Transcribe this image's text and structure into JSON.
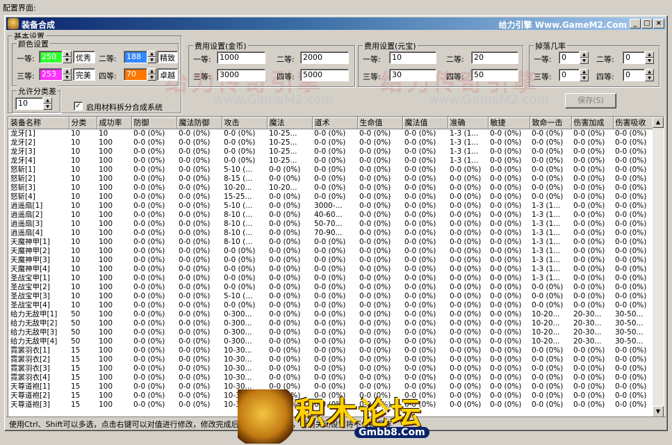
{
  "caption": "配置界面:",
  "window": {
    "title": "装备合成",
    "brand": "给力引擎 Www.GameM2.Com",
    "min_glyph": "_",
    "max_glyph": "□",
    "close_glyph": "×"
  },
  "basic": {
    "group_title": "基本设置",
    "color_group_title": "颜色设置",
    "grades": [
      {
        "label": "一等:",
        "value": "250",
        "color": "#33ff33",
        "name": "优秀"
      },
      {
        "label": "二等:",
        "value": "188",
        "color": "#3388ff",
        "name": "精致"
      },
      {
        "label": "三等:",
        "value": "253",
        "color": "#ff33ff",
        "name": "完美"
      },
      {
        "label": "四等:",
        "value": "70",
        "color": "#ff7700",
        "name": "卓越"
      }
    ],
    "diff_title": "允许分类差",
    "diff_value": "10",
    "checkbox_label": "启用材料拆分合成系统",
    "checkbox_checked": "✓"
  },
  "gold": {
    "title": "费用设置(金币)",
    "items": [
      {
        "label": "一等:",
        "value": "1000"
      },
      {
        "label": "二等:",
        "value": "2000"
      },
      {
        "label": "三等:",
        "value": "3000"
      },
      {
        "label": "四等:",
        "value": "5000"
      }
    ]
  },
  "ingot": {
    "title": "费用设置(元宝)",
    "items": [
      {
        "label": "一等:",
        "value": "10"
      },
      {
        "label": "二等:",
        "value": "20"
      },
      {
        "label": "三等:",
        "value": "30"
      },
      {
        "label": "四等:",
        "value": "50"
      }
    ]
  },
  "drop": {
    "title": "掉落几率",
    "items": [
      {
        "label": "一等:",
        "value": "0"
      },
      {
        "label": "二等:",
        "value": "0"
      },
      {
        "label": "三等:",
        "value": "0"
      },
      {
        "label": "四等:",
        "value": "0"
      }
    ]
  },
  "save_label": "保存(S)",
  "table": {
    "columns": [
      "装备名称",
      "分类",
      "成功率",
      "防御",
      "魔法防御",
      "攻击",
      "魔法",
      "道术",
      "生命值",
      "魔法值",
      "准确",
      "敏捷",
      "致命一击",
      "伤害加成",
      "伤害吸收"
    ],
    "rows": [
      [
        "龙牙[1]",
        "10",
        "10",
        "0-0 (0%)",
        "0-0 (0%)",
        "0-0 (0%)",
        "10-25...",
        "0-0 (0%)",
        "0-0 (0%)",
        "0-0 (0%)",
        "1-3 (1...",
        "0-0 (0%)",
        "0-0 (0%)",
        "0-0 (0%)",
        "0-0 (0%)"
      ],
      [
        "龙牙[2]",
        "10",
        "100",
        "0-0 (0%)",
        "0-0 (0%)",
        "0-0 (0%)",
        "10-25...",
        "0-0 (0%)",
        "0-0 (0%)",
        "0-0 (0%)",
        "1-3 (1...",
        "0-0 (0%)",
        "0-0 (0%)",
        "0-0 (0%)",
        "0-0 (0%)"
      ],
      [
        "龙牙[3]",
        "10",
        "100",
        "0-0 (0%)",
        "0-0 (0%)",
        "0-0 (0%)",
        "10-25...",
        "0-0 (0%)",
        "0-0 (0%)",
        "0-0 (0%)",
        "1-3 (1...",
        "0-0 (0%)",
        "0-0 (0%)",
        "0-0 (0%)",
        "0-0 (0%)"
      ],
      [
        "龙牙[4]",
        "10",
        "100",
        "0-0 (0%)",
        "0-0 (0%)",
        "0-0 (0%)",
        "10-25...",
        "0-0 (0%)",
        "0-0 (0%)",
        "0-0 (0%)",
        "1-3 (1...",
        "0-0 (0%)",
        "0-0 (0%)",
        "0-0 (0%)",
        "0-0 (0%)"
      ],
      [
        "怒斩[1]",
        "10",
        "100",
        "0-0 (0%)",
        "0-0 (0%)",
        "5-10 (...",
        "0-0 (0%)",
        "0-0 (0%)",
        "0-0 (0%)",
        "0-0 (0%)",
        "0-0 (0%)",
        "0-0 (0%)",
        "0-0 (0%)",
        "0-0 (0%)",
        "0-0 (0%)"
      ],
      [
        "怒斩[2]",
        "10",
        "100",
        "0-0 (0%)",
        "0-0 (0%)",
        "8-15 (...",
        "0-0 (0%)",
        "0-0 (0%)",
        "0-0 (0%)",
        "0-0 (0%)",
        "0-0 (0%)",
        "0-0 (0%)",
        "0-0 (0%)",
        "0-0 (0%)",
        "0-0 (0%)"
      ],
      [
        "怒斩[3]",
        "10",
        "100",
        "0-0 (0%)",
        "0-0 (0%)",
        "10-20...",
        "10-20...",
        "0-0 (0%)",
        "0-0 (0%)",
        "0-0 (0%)",
        "0-0 (0%)",
        "0-0 (0%)",
        "0-0 (0%)",
        "0-0 (0%)",
        "0-0 (0%)"
      ],
      [
        "怒斩[4]",
        "10",
        "100",
        "0-0 (0%)",
        "0-0 (0%)",
        "15-25...",
        "0-0 (0%)",
        "0-0 (0%)",
        "0-0 (0%)",
        "0-0 (0%)",
        "0-0 (0%)",
        "0-0 (0%)",
        "0-0 (0%)",
        "0-0 (0%)",
        "0-0 (0%)"
      ],
      [
        "逍遥扇[1]",
        "10",
        "100",
        "0-0 (0%)",
        "0-0 (0%)",
        "5-10 (...",
        "0-0 (0%)",
        "3000-...",
        "0-0 (0%)",
        "0-0 (0%)",
        "0-0 (0%)",
        "0-0 (0%)",
        "1-3 (1...",
        "0-0 (0%)",
        "0-0 (0%)"
      ],
      [
        "逍遥扇[2]",
        "10",
        "100",
        "0-0 (0%)",
        "0-0 (0%)",
        "8-10 (...",
        "0-0 (0%)",
        "40-60...",
        "0-0 (0%)",
        "0-0 (0%)",
        "0-0 (0%)",
        "0-0 (0%)",
        "1-3 (1...",
        "0-0 (0%)",
        "0-0 (0%)"
      ],
      [
        "逍遥扇[3]",
        "10",
        "100",
        "0-0 (0%)",
        "0-0 (0%)",
        "8-10 (...",
        "0-0 (0%)",
        "50-70...",
        "0-0 (0%)",
        "0-0 (0%)",
        "0-0 (0%)",
        "0-0 (0%)",
        "1-3 (1...",
        "0-0 (0%)",
        "0-0 (0%)"
      ],
      [
        "逍遥扇[4]",
        "10",
        "100",
        "0-0 (0%)",
        "0-0 (0%)",
        "8-10 (...",
        "0-0 (0%)",
        "70-90...",
        "0-0 (0%)",
        "0-0 (0%)",
        "0-0 (0%)",
        "0-0 (0%)",
        "1-3 (1...",
        "0-0 (0%)",
        "0-0 (0%)"
      ],
      [
        "天魔神甲[1]",
        "10",
        "100",
        "0-0 (0%)",
        "0-0 (0%)",
        "8-10 (...",
        "0-0 (0%)",
        "0-0 (0%)",
        "0-0 (0%)",
        "0-0 (0%)",
        "0-0 (0%)",
        "0-0 (0%)",
        "1-3 (1...",
        "0-0 (0%)",
        "0-0 (0%)"
      ],
      [
        "天魔神甲[2]",
        "10",
        "100",
        "0-0 (0%)",
        "0-0 (0%)",
        "0-0 (0%)",
        "0-0 (0%)",
        "0-0 (0%)",
        "0-0 (0%)",
        "0-0 (0%)",
        "0-0 (0%)",
        "0-0 (0%)",
        "1-3 (1...",
        "0-0 (0%)",
        "0-0 (0%)"
      ],
      [
        "天魔神甲[3]",
        "10",
        "100",
        "0-0 (0%)",
        "0-0 (0%)",
        "0-0 (0%)",
        "0-0 (0%)",
        "0-0 (0%)",
        "0-0 (0%)",
        "0-0 (0%)",
        "0-0 (0%)",
        "0-0 (0%)",
        "1-3 (1...",
        "0-0 (0%)",
        "0-0 (0%)"
      ],
      [
        "天魔神甲[4]",
        "10",
        "100",
        "0-0 (0%)",
        "0-0 (0%)",
        "0-0 (0%)",
        "0-0 (0%)",
        "0-0 (0%)",
        "0-0 (0%)",
        "0-0 (0%)",
        "0-0 (0%)",
        "0-0 (0%)",
        "1-3 (1...",
        "0-0 (0%)",
        "0-0 (0%)"
      ],
      [
        "圣战宝甲[1]",
        "10",
        "100",
        "0-0 (0%)",
        "0-0 (0%)",
        "0-0 (0%)",
        "0-0 (0%)",
        "0-0 (0%)",
        "0-0 (0%)",
        "0-0 (0%)",
        "0-0 (0%)",
        "0-0 (0%)",
        "1-3 (1...",
        "0-0 (0%)",
        "0-0 (0%)"
      ],
      [
        "圣战宝甲[2]",
        "10",
        "100",
        "0-0 (0%)",
        "0-0 (0%)",
        "0-0 (0%)",
        "0-0 (0%)",
        "0-0 (0%)",
        "0-0 (0%)",
        "0-0 (0%)",
        "0-0 (0%)",
        "0-0 (0%)",
        "0-0 (0%)",
        "0-0 (0%)",
        "0-0 (0%)"
      ],
      [
        "圣战宝甲[3]",
        "10",
        "100",
        "0-0 (0%)",
        "0-0 (0%)",
        "5-10 (...",
        "0-0 (0%)",
        "0-0 (0%)",
        "0-0 (0%)",
        "0-0 (0%)",
        "0-0 (0%)",
        "0-0 (0%)",
        "0-0 (0%)",
        "0-0 (0%)",
        "0-0 (0%)"
      ],
      [
        "圣战宝甲[4]",
        "10",
        "100",
        "0-0 (0%)",
        "0-0 (0%)",
        "0-0 (0%)",
        "0-0 (0%)",
        "0-0 (0%)",
        "0-0 (0%)",
        "0-0 (0%)",
        "0-0 (0%)",
        "0-0 (0%)",
        "0-0 (0%)",
        "0-0 (0%)",
        "0-0 (0%)"
      ],
      [
        "给力无敌甲[1]",
        "50",
        "100",
        "0-0 (0%)",
        "0-0 (0%)",
        "0-300...",
        "0-0 (0%)",
        "0-0 (0%)",
        "0-0 (0%)",
        "0-0 (0%)",
        "0-0 (0%)",
        "0-0 (0%)",
        "10-20...",
        "20-30...",
        "30-50..."
      ],
      [
        "给力无敌甲[2]",
        "50",
        "100",
        "0-0 (0%)",
        "0-0 (0%)",
        "0-300...",
        "0-0 (0%)",
        "0-0 (0%)",
        "0-0 (0%)",
        "0-0 (0%)",
        "0-0 (0%)",
        "0-0 (0%)",
        "10-20...",
        "20-30...",
        "30-50..."
      ],
      [
        "给力无敌甲[3]",
        "50",
        "100",
        "0-0 (0%)",
        "0-0 (0%)",
        "0-300...",
        "0-0 (0%)",
        "0-0 (0%)",
        "0-0 (0%)",
        "0-0 (0%)",
        "0-0 (0%)",
        "0-0 (0%)",
        "10-20...",
        "20-30...",
        "30-50..."
      ],
      [
        "给力无敌甲[4]",
        "50",
        "100",
        "0-0 (0%)",
        "0-0 (0%)",
        "0-300...",
        "0-0 (0%)",
        "0-0 (0%)",
        "0-0 (0%)",
        "0-0 (0%)",
        "0-0 (0%)",
        "0-0 (0%)",
        "10-20...",
        "20-30...",
        "30-50..."
      ],
      [
        "霓裳羽衣[1]",
        "15",
        "100",
        "0-0 (0%)",
        "0-0 (0%)",
        "10-30...",
        "0-0 (0%)",
        "0-0 (0%)",
        "0-0 (0%)",
        "0-0 (0%)",
        "0-0 (0%)",
        "0-0 (0%)",
        "0-0 (0%)",
        "0-0 (0%)",
        "0-0 (0%)"
      ],
      [
        "霓裳羽衣[2]",
        "15",
        "100",
        "0-0 (0%)",
        "0-0 (0%)",
        "10-30...",
        "0-0 (0%)",
        "0-0 (0%)",
        "0-0 (0%)",
        "0-0 (0%)",
        "0-0 (0%)",
        "0-0 (0%)",
        "0-0 (0%)",
        "0-0 (0%)",
        "0-0 (0%)"
      ],
      [
        "霓裳羽衣[3]",
        "15",
        "100",
        "0-0 (0%)",
        "0-0 (0%)",
        "10-30...",
        "0-0 (0%)",
        "0-0 (0%)",
        "0-0 (0%)",
        "0-0 (0%)",
        "0-0 (0%)",
        "0-0 (0%)",
        "0-0 (0%)",
        "0-0 (0%)",
        "0-0 (0%)"
      ],
      [
        "霓裳羽衣[4]",
        "15",
        "100",
        "0-0 (0%)",
        "0-0 (0%)",
        "10-30...",
        "0-0 (0%)",
        "0-0 (0%)",
        "0-0 (0%)",
        "0-0 (0%)",
        "0-0 (0%)",
        "0-0 (0%)",
        "0-0 (0%)",
        "0-0 (0%)",
        "0-0 (0%)"
      ],
      [
        "天尊道袍[1]",
        "15",
        "100",
        "0-0 (0%)",
        "0-0 (0%)",
        "10-30...",
        "0-0 (0%)",
        "0-0 (0%)",
        "0-0 (0%)",
        "0-0 (0%)",
        "0-0 (0%)",
        "0-0 (0%)",
        "0-0 (0%)",
        "0-0 (0%)",
        "0-0 (0%)"
      ],
      [
        "天尊道袍[2]",
        "15",
        "100",
        "0-0 (0%)",
        "0-0 (0%)",
        "10-30...",
        "0-0 (0%)",
        "0-0 (0%)",
        "0-0 (0%)",
        "0-0 (0%)",
        "0-0 (0%)",
        "0-0 (0%)",
        "0-0 (0%)",
        "0-0 (0%)",
        "0-0 (0%)"
      ],
      [
        "天尊道袍[3]",
        "15",
        "100",
        "0-0 (0%)",
        "0-0 (0%)",
        "10-30...",
        "0-0 (0%)",
        "0-0 (0%)",
        "0-0 (0%)",
        "0-0 (0%)",
        "0-0 (0%)",
        "0-0 (0%)",
        "0-0 (0%)",
        "0-0 (0%)",
        "0-0 (0%)"
      ]
    ]
  },
  "watermarks": {
    "text": "给力传奇引擎",
    "url": "www.GameM2.com"
  },
  "logo": {
    "text": "积木论坛",
    "url": "Gmbb8.Com"
  },
  "status": "使用Ctrl、Shift可以多选，点击右键可以对值进行修改，修改完成后请注意保存修改，否则关闭设置将不会被保存",
  "scroll": {
    "up": "▲",
    "down": "▼"
  }
}
